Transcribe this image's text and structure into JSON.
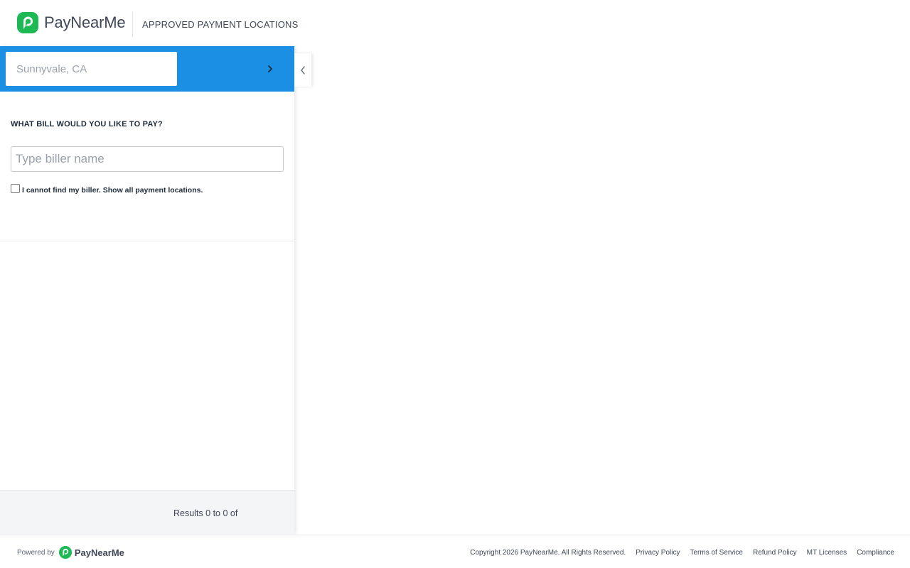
{
  "header": {
    "brand": "PayNearMe",
    "subtitle": "APPROVED PAYMENT LOCATIONS"
  },
  "search": {
    "location_placeholder": "Sunnyvale, CA",
    "go_icon": "chevron-right-icon"
  },
  "bill": {
    "heading": "WHAT BILL WOULD YOU LIKE TO PAY?",
    "biller_placeholder": "Type biller name",
    "checkbox_label": "I cannot find my biller. Show all payment locations.",
    "checkbox_checked": false
  },
  "results": {
    "text": "Results 0 to 0 of"
  },
  "toggle": {
    "icon": "chevron-left-icon"
  },
  "footer": {
    "powered_by": "Powered by",
    "brand": "PayNearMe",
    "copyright": "Copyright 2026 PayNearMe. All Rights Reserved.",
    "links": [
      "Privacy Policy",
      "Terms of Service",
      "Refund Policy",
      "MT Licenses",
      "Compliance"
    ]
  },
  "colors": {
    "brand_green": "#1db954",
    "accent_blue": "#1a8fe3"
  }
}
